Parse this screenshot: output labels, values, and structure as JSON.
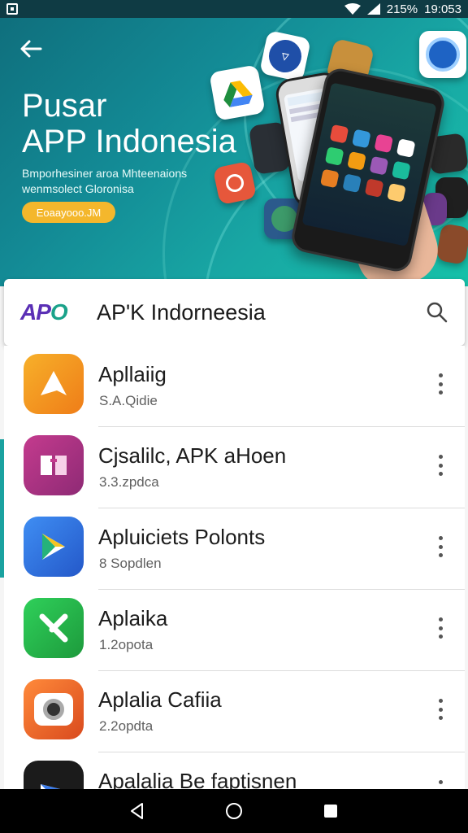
{
  "status_bar": {
    "battery": "215%",
    "time": "19:053"
  },
  "hero": {
    "back_icon": "arrow-left-icon",
    "title_line1": "Pusar",
    "title_line2": "APP Indonesia",
    "subtitle_line1": "Bmporhesiner aroa Mhteenaions",
    "subtitle_line2": "wenmsolect Gloronisa",
    "badge": "Eoaayooo.JM"
  },
  "search": {
    "logo_a": "AP",
    "logo_b": "O",
    "logo_c": "",
    "title": "AP'K Indorneesia",
    "icon": "search-icon"
  },
  "apps": [
    {
      "name": "Apllaiig",
      "meta": "S.A.Qidie",
      "icon_color": "#f29a1c"
    },
    {
      "name": "Cjsalilc, APK aHoen",
      "meta": "3.3.zpdca",
      "icon_color": "#b23a8c"
    },
    {
      "name": "Apluiciets Polonts",
      "meta": "8 Sopdlen",
      "icon_color": "#2f74e6"
    },
    {
      "name": "Aplaika",
      "meta": "1.2opota",
      "icon_color": "#27b24a"
    },
    {
      "name": "Aplalia Cafiia",
      "meta": "2.2opdta",
      "icon_color": "#f06a2a"
    },
    {
      "name": "Apalalia Be faptisnen",
      "meta": "",
      "icon_color": "#1b1b1b"
    }
  ],
  "nav": {
    "back": "back-triangle-icon",
    "home": "home-circle-icon",
    "recents": "recents-square-icon"
  },
  "colors": {
    "accent": "#16a3a3",
    "badge": "#f4b72c"
  }
}
